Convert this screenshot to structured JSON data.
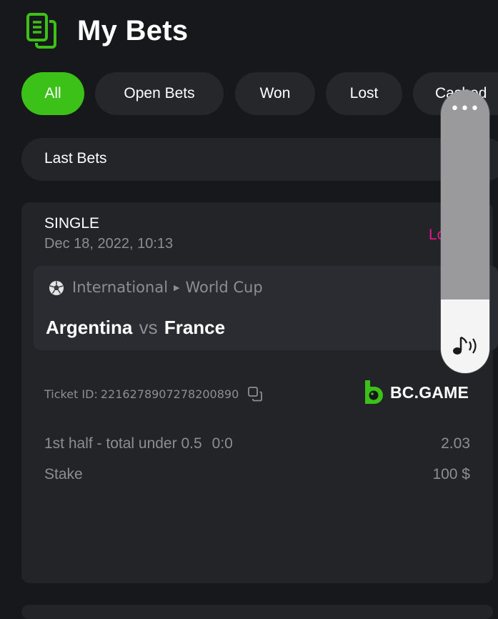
{
  "header": {
    "title": "My Bets",
    "icon": "bets-document-icon"
  },
  "tabs": [
    {
      "label": "All",
      "active": true
    },
    {
      "label": "Open Bets",
      "active": false
    },
    {
      "label": "Won",
      "active": false
    },
    {
      "label": "Lost",
      "active": false
    },
    {
      "label": "Cashed",
      "active": false
    }
  ],
  "filter": {
    "label": "Last Bets"
  },
  "bet": {
    "type": "SINGLE",
    "date": "Dec 18, 2022, 10:13",
    "status": "Lost",
    "status_color": "#e8168c",
    "match": {
      "category": "International",
      "league": "World Cup",
      "team_home": "Argentina",
      "vs": "vs",
      "team_away": "France"
    },
    "ticket_label": "Ticket ID:",
    "ticket_id": "2216278907278200890",
    "brand": "BC.GAME",
    "selection": "1st half - total under 0.5",
    "score": "0:0",
    "odds": "2.03",
    "stake_label": "Stake",
    "stake_value": "100 $"
  },
  "colors": {
    "accent": "#3bc117",
    "background": "#17181b",
    "card": "#222428"
  },
  "volume": {
    "level": 0.26
  }
}
